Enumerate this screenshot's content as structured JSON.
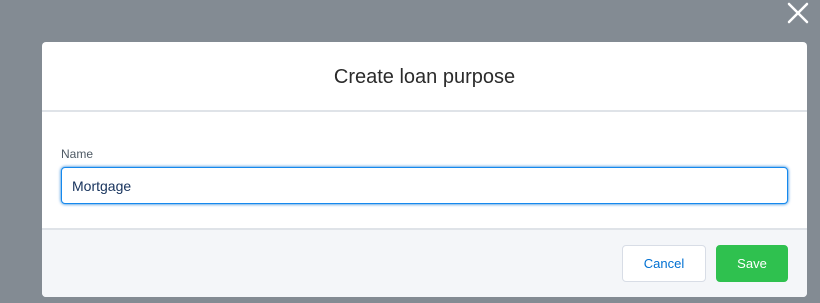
{
  "overlay": {
    "close_icon": "close-icon"
  },
  "modal": {
    "title": "Create loan purpose",
    "field": {
      "label": "Name",
      "value": "Mortgage"
    },
    "footer": {
      "cancel_label": "Cancel",
      "save_label": "Save"
    }
  },
  "colors": {
    "backdrop": "#838b93",
    "save_button": "#2fc14f",
    "cancel_text": "#0070d2",
    "input_focus": "#1589ee"
  }
}
